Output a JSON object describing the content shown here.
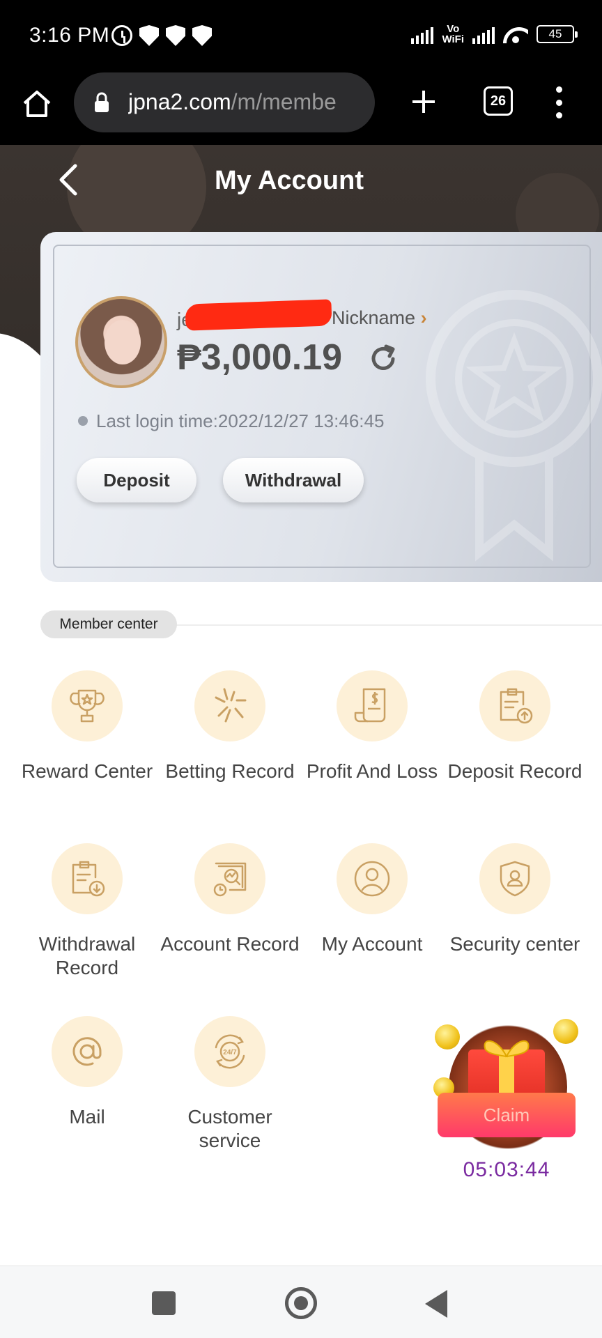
{
  "status_bar": {
    "time": "3:16 PM",
    "vowifi_top": "Vo",
    "vowifi_bottom": "WiFi",
    "battery": "45"
  },
  "browser": {
    "url_host": "jpna2.com",
    "url_path": "/m/membe",
    "tab_count": "26"
  },
  "header": {
    "title": "My Account"
  },
  "account": {
    "username_visible": "je",
    "nickname_link": "Nickname",
    "balance": "₱3,000.19",
    "last_login": "Last login time:2022/12/27 13:46:45",
    "deposit_button": "Deposit",
    "withdrawal_button": "Withdrawal"
  },
  "member_center": {
    "title": "Member center",
    "items": [
      {
        "label": "Reward Center",
        "icon": "trophy-icon"
      },
      {
        "label": "Betting Record",
        "icon": "betting-icon"
      },
      {
        "label": "Profit And Loss",
        "icon": "receipt-dollar-icon"
      },
      {
        "label": "Deposit Record",
        "icon": "clipboard-upload-icon"
      },
      {
        "label": "Withdrawal Record",
        "icon": "clipboard-download-icon"
      },
      {
        "label": "Account Record",
        "icon": "search-chart-icon"
      },
      {
        "label": "My Account",
        "icon": "user-icon"
      },
      {
        "label": "Security center",
        "icon": "shield-user-icon"
      },
      {
        "label": "Mail",
        "icon": "at-icon"
      },
      {
        "label": "Customer service",
        "icon": "support-24-7-icon"
      }
    ]
  },
  "promo": {
    "claim_label": "Claim",
    "timer": "05:03:44"
  },
  "colors": {
    "header_bg": "#3b3430",
    "icon_bg": "#fdf0d7",
    "icon_stroke": "#c9a063",
    "claim_gradient_start": "#ff7a4a",
    "claim_gradient_end": "#ff3a6a"
  }
}
